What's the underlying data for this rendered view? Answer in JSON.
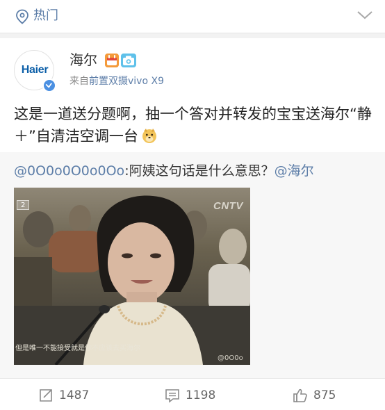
{
  "header": {
    "title": "热门",
    "colors": {
      "link": "#5d7ea8"
    }
  },
  "post": {
    "avatar_logo_text": "Haier",
    "username": "海尔",
    "source_prefix": "来自",
    "source_device": "前置双摄vivo X9",
    "text": "这是一道送分题啊，抽一个答对并转发的宝宝送海尔“静＋”自清洁空调一台"
  },
  "retweet": {
    "mention_user": "@0O0o0O0o0Oo",
    "text": ":阿姨这句话是什么意思？",
    "mention_target": "@海尔",
    "video": {
      "caption": "但是唯一不能接受就是你不应该去买海尔",
      "channel": "CNTV",
      "watermark": "@0O0o",
      "episode_badge": "2"
    }
  },
  "actions": {
    "repost_count": "1487",
    "comment_count": "1198",
    "like_count": "875"
  }
}
